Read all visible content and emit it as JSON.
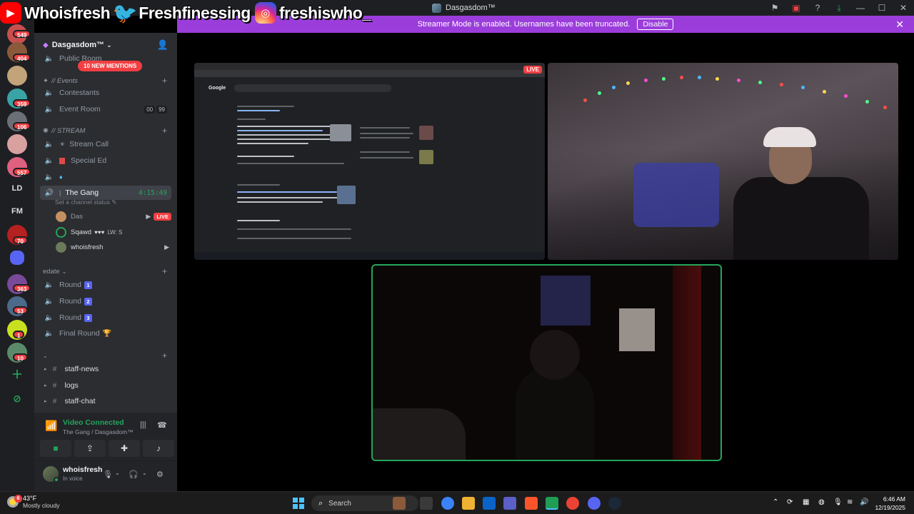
{
  "window": {
    "title": "Dasgasdom™"
  },
  "overlay": {
    "youtube": "Whoisfresh",
    "twitter": "Freshfinessing",
    "instagram": "freshiswho_"
  },
  "banner": {
    "text": "Streamer Mode is enabled. Usernames have been truncated.",
    "button": "Disable"
  },
  "servers": {
    "badges": [
      "549",
      "404",
      "359",
      "106",
      "557",
      "70",
      "363",
      "53",
      "1",
      "10"
    ],
    "text_servers": [
      "LD",
      "FM"
    ]
  },
  "sidebar": {
    "server_name": "Dasgasdom™",
    "mentions": "10 NEW MENTIONS",
    "channels": {
      "public_room": "Public Room",
      "events_category": "// Events",
      "contestants": "Contestants",
      "event_room": "Event Room",
      "event_room_counts": [
        "00",
        "99"
      ],
      "stream_category": "// STREAM",
      "stream_call": "Stream Call",
      "special_ed": "Special Ed",
      "the_gang": "The Gang",
      "the_gang_time": "4:15:49",
      "set_status": "Set a channel status",
      "edate_category": "edate",
      "round1": "Round",
      "round2": "Round",
      "round3": "Round",
      "round_nums": [
        "1",
        "2",
        "3"
      ],
      "final_round": "Final Round",
      "staff_news": "staff-news",
      "logs": "logs",
      "staff_chat": "staff-chat"
    },
    "voice_users": [
      {
        "name": "Das",
        "badge": "LIVE"
      },
      {
        "name": "Sqawd",
        "extra": "LW: S"
      },
      {
        "name": "whoisfresh"
      }
    ]
  },
  "voice": {
    "status": "Video Connected",
    "location": "The Gang / Dasgasdom™"
  },
  "user": {
    "name": "whoisfresh",
    "status": "In voice"
  },
  "stream": {
    "live": "LIVE"
  },
  "taskbar": {
    "weather_temp": "43°F",
    "weather_desc": "Mostly cloudy",
    "weather_badge": "6",
    "search": "Search",
    "time": "6:46 AM",
    "date": "12/19/2025"
  },
  "colors": {
    "accent": "#5865f2",
    "banner": "#9b3ddb",
    "online": "#23a55a",
    "danger": "#f23f43"
  }
}
